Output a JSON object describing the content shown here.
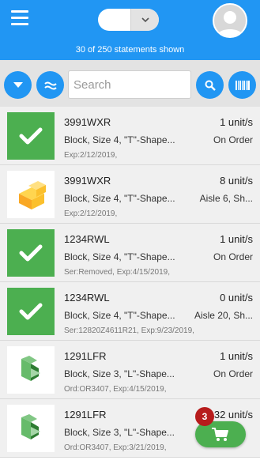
{
  "header": {
    "statements_text": "30 of 250 statements shown",
    "brand_color": "#2196f3"
  },
  "toolbar": {
    "search_placeholder": "Search"
  },
  "items": [
    {
      "name": "3991WXR",
      "qty": "1 unit/s",
      "desc": "Block, Size 4, \"T\"-Shape...",
      "loc": "On Order",
      "meta": "Exp:2/12/2019,",
      "thumb": "check-icon"
    },
    {
      "name": "3991WXR",
      "qty": "8 unit/s",
      "desc": "Block, Size 4, \"T\"-Shape...",
      "loc": "Aisle 6, Sh...",
      "meta": "Exp:2/12/2019,",
      "thumb": "yellow-t-block"
    },
    {
      "name": "1234RWL",
      "qty": "1 unit/s",
      "desc": "Block, Size 4, \"T\"-Shape...",
      "loc": "On Order",
      "meta": "Ser:Removed, Exp:4/15/2019,",
      "thumb": "check-icon"
    },
    {
      "name": "1234RWL",
      "qty": "0 unit/s",
      "desc": "Block, Size 4, \"T\"-Shape...",
      "loc": "Aisle 20, Sh...",
      "meta": "Ser:12820Z4611R21, Exp:9/23/2019,",
      "thumb": "check-icon"
    },
    {
      "name": "1291LFR",
      "qty": "1 unit/s",
      "desc": "Block, Size 3, \"L\"-Shape...",
      "loc": "On Order",
      "meta": "Ord:OR3407, Exp:4/15/2019,",
      "thumb": "green-l-block"
    },
    {
      "name": "1291LFR",
      "qty": "32 unit/s",
      "desc": "Block, Size 3, \"L\"-Shape...",
      "loc": "",
      "meta": "Ord:OR3407, Exp:3/21/2019,",
      "thumb": "green-l-block"
    }
  ],
  "cart": {
    "count": "3"
  }
}
